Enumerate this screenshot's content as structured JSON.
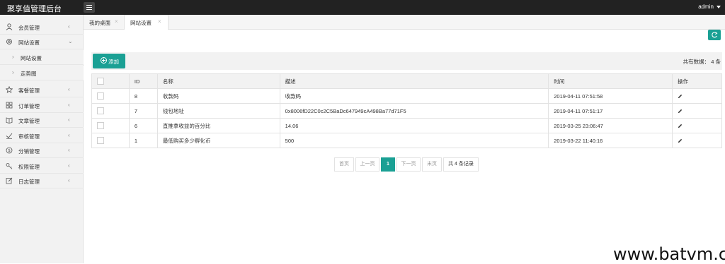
{
  "app": {
    "title": "聚享值管理后台",
    "user": "admin"
  },
  "sidebar": {
    "items": [
      {
        "label": "会员管理",
        "icon": "user-icon",
        "expanded": false
      },
      {
        "label": "网站设置",
        "icon": "gear-icon",
        "expanded": true
      },
      {
        "label": "客餐管理",
        "icon": "star-icon",
        "expanded": false
      },
      {
        "label": "订单管理",
        "icon": "grid-icon",
        "expanded": false
      },
      {
        "label": "文章管理",
        "icon": "book-icon",
        "expanded": false
      },
      {
        "label": "审核管理",
        "icon": "check-icon",
        "expanded": false
      },
      {
        "label": "分销管理",
        "icon": "coin-icon",
        "expanded": false
      },
      {
        "label": "权限管理",
        "icon": "key-icon",
        "expanded": false
      },
      {
        "label": "日志管理",
        "icon": "edit-icon",
        "expanded": false
      }
    ],
    "subitems": [
      {
        "label": "网站设置"
      },
      {
        "label": "走势图"
      }
    ]
  },
  "tabs": [
    {
      "label": "我的桌面",
      "active": false
    },
    {
      "label": "网站设置",
      "active": true
    }
  ],
  "toolbar": {
    "add_label": "添加",
    "total_label": "共有数据： 4 条"
  },
  "table": {
    "headers": [
      "",
      "ID",
      "名称",
      "描述",
      "时间",
      "操作"
    ],
    "rows": [
      {
        "id": "8",
        "name": "收款码",
        "desc": "收款码",
        "time": "2019-04-11 07:51:58"
      },
      {
        "id": "7",
        "name": "钱包地址",
        "desc": "0x8006fD22C0c2C5BaDc647949cA498Ba77d71F5",
        "time": "2019-04-11 07:51:17"
      },
      {
        "id": "6",
        "name": "直推拿收益的百分比",
        "desc": "14.06",
        "time": "2019-03-25 23:06:47"
      },
      {
        "id": "1",
        "name": "最低购买多少孵化币",
        "desc": "500",
        "time": "2019-03-22 11:40:16"
      }
    ]
  },
  "pagination": {
    "first": "首页",
    "prev": "上一页",
    "current": "1",
    "next": "下一页",
    "last": "末页",
    "info": "共 4 条记录"
  },
  "watermark": "www.batvm.com",
  "colors": {
    "accent": "#1aa094",
    "topbar": "#222222",
    "sidebar": "#f2f2f2"
  }
}
